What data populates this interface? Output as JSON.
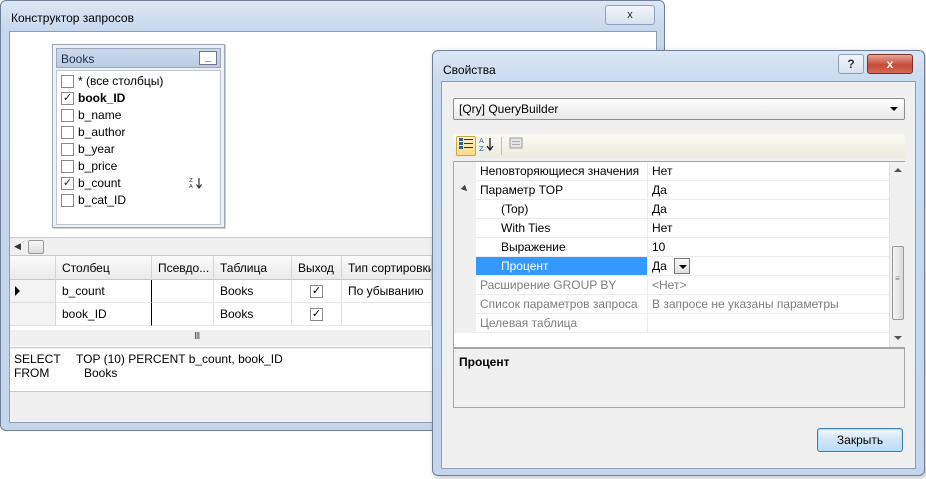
{
  "query_builder": {
    "title": "Конструктор запросов",
    "close_glyph": "x",
    "table": {
      "name": "Books",
      "minimize_glyph": "_",
      "columns": [
        {
          "label": "* (все столбцы)",
          "checked": false,
          "bold": false
        },
        {
          "label": "book_ID",
          "checked": true,
          "bold": true
        },
        {
          "label": "b_name",
          "checked": false,
          "bold": false
        },
        {
          "label": "b_author",
          "checked": false,
          "bold": false
        },
        {
          "label": "b_year",
          "checked": false,
          "bold": false
        },
        {
          "label": "b_price",
          "checked": false,
          "bold": false
        },
        {
          "label": "b_count",
          "checked": true,
          "bold": false,
          "sort_icon": "sort-descending-icon"
        },
        {
          "label": "b_cat_ID",
          "checked": false,
          "bold": false
        }
      ]
    },
    "grid": {
      "headers": [
        "Столбец",
        "Псевдо...",
        "Таблица",
        "Выход",
        "Тип сортировки"
      ],
      "rows": [
        {
          "column": "b_count",
          "alias": "",
          "table": "Books",
          "output": true,
          "sort": "По убыванию",
          "current": true
        },
        {
          "column": "book_ID",
          "alias": "",
          "table": "Books",
          "output": true,
          "sort": "",
          "current": false
        }
      ],
      "scroll_grip": "III"
    },
    "sql": {
      "line1_kw": "SELECT",
      "line1_body": "TOP (10) PERCENT b_count, book_ID",
      "line2_kw": "FROM",
      "line2_body": "Books"
    }
  },
  "properties": {
    "title": "Свойства",
    "help_glyph": "?",
    "close_glyph": "x",
    "object_selector": "[Qry] QueryBuilder",
    "toolbar": {
      "categorized_icon": "categorized-icon",
      "alphabetical_icon": "sort-az-icon",
      "pages_icon": "property-pages-icon"
    },
    "rows": [
      {
        "name": "Неповторяющиеся значения",
        "value": "Нет",
        "kind": "normal"
      },
      {
        "name": "Параметр TOP",
        "value": "Да",
        "kind": "group"
      },
      {
        "name": "(Top)",
        "value": "Да",
        "kind": "indent"
      },
      {
        "name": "With Ties",
        "value": "Нет",
        "kind": "indent"
      },
      {
        "name": "Выражение",
        "value": "10",
        "kind": "indent"
      },
      {
        "name": "Процент",
        "value": "Да",
        "kind": "selected"
      },
      {
        "name": "Расширение GROUP BY",
        "value": "<Нет>",
        "kind": "disabled"
      },
      {
        "name": "Список параметров запроса",
        "value": "В запросе не указаны параметры",
        "kind": "disabled"
      },
      {
        "name": "Целевая таблица",
        "value": "",
        "kind": "disabled"
      }
    ],
    "description_title": "Процент",
    "close_button": "Закрыть"
  },
  "colors": {
    "selection": "#3399ff",
    "window_frame": "#c5d6ec",
    "close_red": "#c44d3b"
  }
}
